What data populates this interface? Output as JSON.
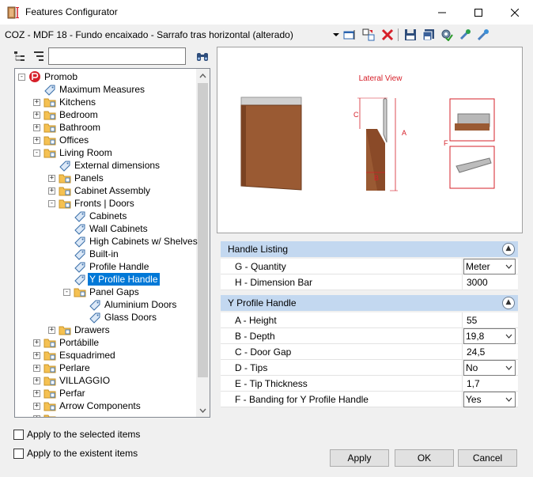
{
  "window": {
    "title": "Features Configurator"
  },
  "toolbar": {
    "path": "COZ - MDF 18 - Fundo encaixado - Sarrafo tras horizontal (alterado)",
    "icons": [
      "dropdown-arrow-icon",
      "edit-window-icon",
      "split-icon",
      "delete-icon",
      "save-icon",
      "save-as-icon",
      "settings-check-icon",
      "tool-wrench-icon",
      "pin-icon"
    ]
  },
  "filter": {
    "value": "",
    "icons": [
      "tree-view-icon",
      "tree-levels-icon",
      "binoculars-icon"
    ]
  },
  "tree": {
    "items": [
      {
        "label": "Promob",
        "level": 0,
        "expander": "-",
        "icon": "promob"
      },
      {
        "label": "Maximum Measures",
        "level": 1,
        "expander": "",
        "icon": "tag"
      },
      {
        "label": "Kitchens",
        "level": 1,
        "expander": "+",
        "icon": "folder"
      },
      {
        "label": "Bedroom",
        "level": 1,
        "expander": "+",
        "icon": "folder"
      },
      {
        "label": "Bathroom",
        "level": 1,
        "expander": "+",
        "icon": "folder"
      },
      {
        "label": "Offices",
        "level": 1,
        "expander": "+",
        "icon": "folder"
      },
      {
        "label": "Living Room",
        "level": 1,
        "expander": "-",
        "icon": "folder"
      },
      {
        "label": "External dimensions",
        "level": 2,
        "expander": "",
        "icon": "tag"
      },
      {
        "label": "Panels",
        "level": 2,
        "expander": "+",
        "icon": "folder"
      },
      {
        "label": "Cabinet Assembly",
        "level": 2,
        "expander": "+",
        "icon": "folder"
      },
      {
        "label": "Fronts | Doors",
        "level": 2,
        "expander": "-",
        "icon": "folder"
      },
      {
        "label": "Cabinets",
        "level": 3,
        "expander": "",
        "icon": "tag"
      },
      {
        "label": "Wall Cabinets",
        "level": 3,
        "expander": "",
        "icon": "tag"
      },
      {
        "label": "High Cabinets w/ Shelves",
        "level": 3,
        "expander": "",
        "icon": "tag"
      },
      {
        "label": "Built-in",
        "level": 3,
        "expander": "",
        "icon": "tag"
      },
      {
        "label": "Profile Handle",
        "level": 3,
        "expander": "",
        "icon": "tag"
      },
      {
        "label": "Y Profile Handle",
        "level": 3,
        "expander": "",
        "icon": "tag",
        "selected": true
      },
      {
        "label": "Panel Gaps",
        "level": 3,
        "expander": "-",
        "icon": "folder"
      },
      {
        "label": "Aluminium Doors",
        "level": 4,
        "expander": "",
        "icon": "tag"
      },
      {
        "label": "Glass Doors",
        "level": 4,
        "expander": "",
        "icon": "tag"
      },
      {
        "label": "Drawers",
        "level": 2,
        "expander": "+",
        "icon": "folder"
      },
      {
        "label": "Portábille",
        "level": 1,
        "expander": "+",
        "icon": "folder"
      },
      {
        "label": "Esquadrimed",
        "level": 1,
        "expander": "+",
        "icon": "folder"
      },
      {
        "label": "Perlare",
        "level": 1,
        "expander": "+",
        "icon": "folder"
      },
      {
        "label": "VILLAGGIO",
        "level": 1,
        "expander": "+",
        "icon": "folder"
      },
      {
        "label": "Perfar",
        "level": 1,
        "expander": "+",
        "icon": "folder"
      },
      {
        "label": "Arrow Components",
        "level": 1,
        "expander": "+",
        "icon": "folder"
      },
      {
        "label": "",
        "level": 1,
        "expander": "+",
        "icon": "folder"
      }
    ]
  },
  "options": {
    "apply_selected": "Apply to the selected items",
    "apply_existent": "Apply to the existent items"
  },
  "preview": {
    "view_label": "Lateral View",
    "dims": {
      "a": "A",
      "b": "B",
      "c": "C",
      "f": "F"
    }
  },
  "properties": {
    "sections": [
      {
        "title": "Handle Listing",
        "rows": [
          {
            "name": "G - Quantity",
            "value": "Meter",
            "select": true
          },
          {
            "name": "H - Dimension Bar",
            "value": "3000",
            "select": false
          }
        ]
      },
      {
        "title": "Y Profile Handle",
        "rows": [
          {
            "name": "A - Height",
            "value": "55",
            "select": false
          },
          {
            "name": "B - Depth",
            "value": "19,8",
            "select": true
          },
          {
            "name": "C - Door Gap",
            "value": "24,5",
            "select": false
          },
          {
            "name": "D - Tips",
            "value": "No",
            "select": true
          },
          {
            "name": "E - Tip Thickness",
            "value": "1,7",
            "select": false
          },
          {
            "name": "F - Banding for Y Profile Handle",
            "value": "Yes",
            "select": true
          }
        ]
      }
    ]
  },
  "buttons": {
    "apply": "Apply",
    "ok": "OK",
    "cancel": "Cancel"
  },
  "colors": {
    "selection": "#0078d7",
    "section_header": "#c3d8f0",
    "folder": "#f5c152",
    "annotation_red": "#d6202a",
    "wood": "#9a5a33"
  }
}
